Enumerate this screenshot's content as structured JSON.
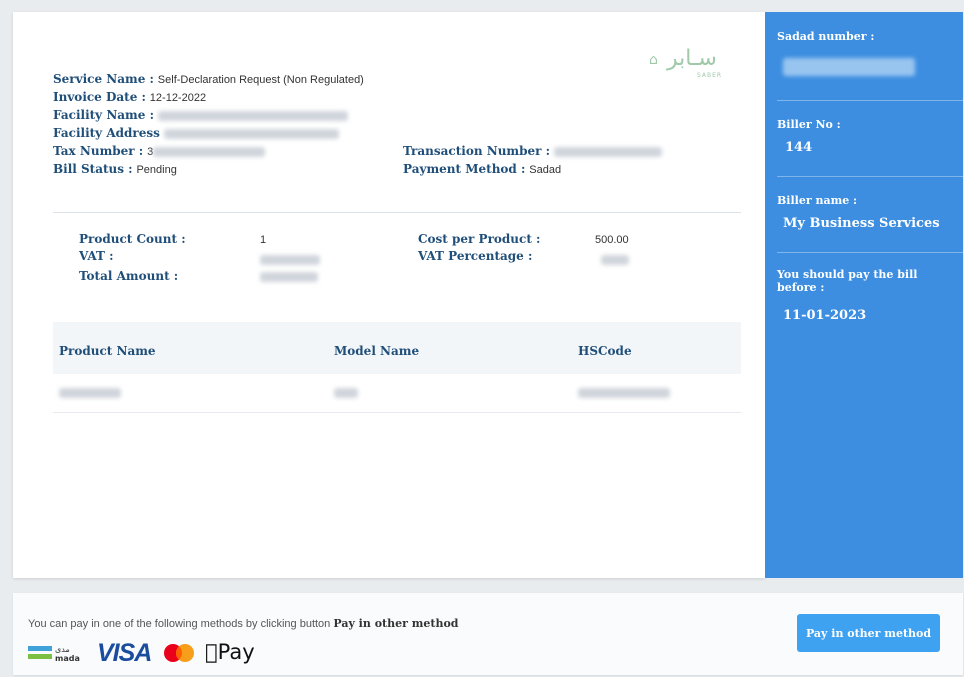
{
  "invoice": {
    "service_name_label": "Service Name :",
    "service_name_value": "Self-Declaration Request (Non Regulated)",
    "invoice_date_label": "Invoice Date :",
    "invoice_date_value": "12-12-2022",
    "facility_name_label": "Facility Name :",
    "facility_address_label": "Facility Address",
    "tax_number_label": "Tax Number :",
    "tax_number_prefix": "3",
    "bill_status_label": "Bill Status :",
    "bill_status_value": "Pending",
    "transaction_number_label": "Transaction Number :",
    "payment_method_label": "Payment Method :",
    "payment_method_value": "Sadad"
  },
  "summary": {
    "product_count_label": "Product Count :",
    "product_count_value": "1",
    "vat_label": "VAT :",
    "total_amount_label": "Total Amount :",
    "cost_per_product_label": "Cost per Product :",
    "cost_per_product_value": "500.00",
    "vat_percentage_label": "VAT Percentage :"
  },
  "table": {
    "headers": [
      "Product Name",
      "Model Name",
      "HSCode"
    ]
  },
  "sidebar": {
    "sadad_number_label": "Sadad number :",
    "biller_no_label": "Biller No :",
    "biller_no_value": "144",
    "biller_name_label": "Biller name :",
    "biller_name_value": "My Business Services",
    "pay_before_label": "You should pay the bill before :",
    "pay_before_value": "11-01-2023"
  },
  "footer": {
    "text": "You can pay in one of the following methods by clicking button",
    "text_bold": "Pay in other method",
    "pay_button_label": "Pay in other method",
    "visa_label": "VISA",
    "apple_pay_label": "Pay",
    "mada_label": "مدى",
    "mada_latin": "mada"
  },
  "logo": {
    "arabic": "سـابر",
    "sub": "SABER"
  },
  "colors": {
    "accent": "#3d8ee0",
    "button": "#3fa2f0",
    "label": "#1f4e79"
  }
}
